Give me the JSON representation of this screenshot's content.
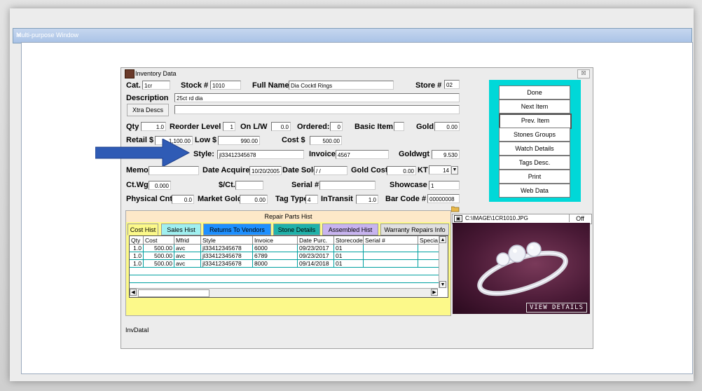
{
  "outer_window": {
    "title": "Multi-purpose Window"
  },
  "dialog": {
    "title": "Inventory Data",
    "close": "☒"
  },
  "fields": {
    "cat_label": "Cat.",
    "cat_value": "1cr",
    "stock_label": "Stock #",
    "stock_value": "1010",
    "fullname_label": "Full Name",
    "fullname_value": "Dia Cocktl Rings",
    "store_label": "Store #",
    "store_value": "02",
    "description_label": "Description",
    "description_value": "25ct rd dia",
    "xtra_descs_label": "Xtra Descs",
    "qty_label": "Qty",
    "qty_value": "1.0",
    "reorder_label": "Reorder Level",
    "reorder_value": "1",
    "onlw_label": "On L/W",
    "onlw_value": "0.0",
    "ordered_label": "Ordered:",
    "ordered_value": "0",
    "basic_item_label": "Basic Item",
    "gold_label": "Gold",
    "gold_value": "0.00",
    "retail_label": "Retail $",
    "retail_value": "1,100.00",
    "low_label": "Low $",
    "low_value": "990.00",
    "cost_label": "Cost $",
    "cost_value": "500.00",
    "style_label": "Style:",
    "style_value": "jl33412345678",
    "invoice_label": "Invoice",
    "invoice_value": "4567",
    "goldwgt_label": "Goldwgt",
    "goldwgt_value": "9.530",
    "memo_label": "Memo",
    "date_acq_label": "Date Acquired",
    "date_acq_value": "10/20/2005",
    "date_sold_label": "Date Sold",
    "date_sold_value": "/ /",
    "gold_cost_label": "Gold Cost",
    "gold_cost_value": "0.00",
    "kt_label": "KT",
    "kt_value": "14",
    "ctwgt_label": "Ct.Wgt.",
    "ctwgt_value": "0.000",
    "sct_label": "$/Ct.",
    "serial_label": "Serial #",
    "showcase_label": "Showcase",
    "showcase_value": "1",
    "physical_label": "Physical Cnt.",
    "physical_value": "0.0",
    "market_gold_label": "Market Gold",
    "market_gold_value": "0.00",
    "tag_type_label": "Tag Type",
    "tag_type_value": "4",
    "intransit_label": "InTransit",
    "intransit_value": "1.0",
    "barcode_label": "Bar Code #",
    "barcode_value": "00000008"
  },
  "right_panel": {
    "buttons": [
      "Done",
      "Next Item",
      "Prev. Item",
      "Stones Groups",
      "Watch Details",
      "Tags Desc.",
      "Print",
      "Web Data"
    ]
  },
  "repair_parts": {
    "label": "Repair Parts Hist"
  },
  "tabs": [
    {
      "label": "Cost Hist",
      "color": "#fcf98a"
    },
    {
      "label": "Sales Hist",
      "color": "#a0f0f0"
    },
    {
      "label": "Returns To Vendors",
      "color": "#1e90ff"
    },
    {
      "label": "Stone Details",
      "color": "#20b2aa"
    },
    {
      "label": "Assembled Hist",
      "color": "#c8b4f0"
    },
    {
      "label": "Warranty Repairs Info",
      "color": "#e0e0e0"
    }
  ],
  "grid": {
    "headers": [
      "Qty",
      "Cost",
      "Mfrid",
      "Style",
      "Invoice",
      "Date Purc.",
      "Storecode",
      "Serial #",
      "Specia"
    ],
    "rows": [
      [
        "1.0",
        "500.00",
        "avc",
        "jl33412345678",
        "6000",
        "09/23/2017",
        "01",
        "",
        ""
      ],
      [
        "1.0",
        "500.00",
        "avc",
        "jl33412345678",
        "6789",
        "09/23/2017",
        "01",
        "",
        ""
      ],
      [
        "1.0",
        "500.00",
        "avc",
        "jl33412345678",
        "8000",
        "09/14/2018",
        "01",
        "",
        ""
      ]
    ]
  },
  "image": {
    "path": "C:\\IMAGE\\1CR1010.JPG",
    "toggle": "Off",
    "overlay": "VIEW DETAILS"
  },
  "status": {
    "text": "InvDataI"
  },
  "colors": {
    "accent_panel": "#00d8d8",
    "arrow": "#2f5bb5",
    "lower_bg": "#fcf98a"
  }
}
